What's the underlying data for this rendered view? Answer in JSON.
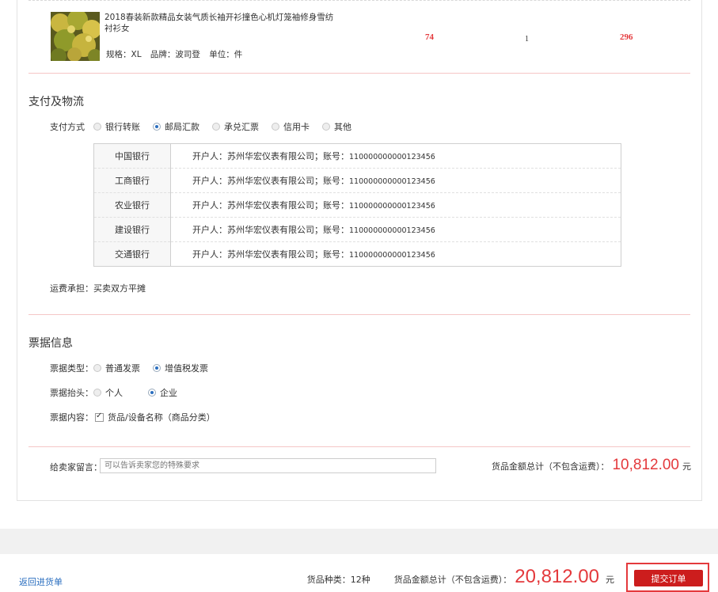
{
  "product": {
    "name": "2018春装新款精品女装气质长袖开衫撞色心机灯笼袖修身雪纺衬衫女",
    "spec_label": "规格：XL",
    "brand_label": "品牌：波司登",
    "unit_label": "单位：件",
    "price": "74",
    "quantity": "1",
    "subtotal": "296"
  },
  "payment": {
    "title": "支付及物流",
    "method_label": "支付方式",
    "options": [
      {
        "label": "银行转账",
        "checked": false
      },
      {
        "label": "邮局汇款",
        "checked": true
      },
      {
        "label": "承兑汇票",
        "checked": false
      },
      {
        "label": "信用卡",
        "checked": false
      },
      {
        "label": "其他",
        "checked": false
      }
    ],
    "banks": [
      {
        "name": "中国银行",
        "info": "开户人：苏州华宏仪表有限公司；账号：",
        "account": "110000000000123456"
      },
      {
        "name": "工商银行",
        "info": "开户人：苏州华宏仪表有限公司；账号：",
        "account": "110000000000123456"
      },
      {
        "name": "农业银行",
        "info": "开户人：苏州华宏仪表有限公司；账号：",
        "account": "110000000000123456"
      },
      {
        "name": "建设银行",
        "info": "开户人：苏州华宏仪表有限公司；账号：",
        "account": "110000000000123456"
      },
      {
        "name": "交通银行",
        "info": "开户人：苏州华宏仪表有限公司；账号：",
        "account": "110000000000123456"
      }
    ],
    "freight_note": "运费承担：买卖双方平摊"
  },
  "invoice": {
    "title": "票据信息",
    "type_label": "票据类型：",
    "type_options": [
      {
        "label": "普通发票",
        "checked": false
      },
      {
        "label": "增值税发票",
        "checked": true
      }
    ],
    "header_label": "票据抬头：",
    "header_options": [
      {
        "label": "个人",
        "checked": false
      },
      {
        "label": "企业",
        "checked": true
      }
    ],
    "content_label": "票据内容：",
    "content_option": {
      "label": "货品/设备名称（商品分类）",
      "checked": true
    }
  },
  "remark": {
    "label": "给卖家留言：",
    "placeholder": "可以告诉卖家您的特殊要求"
  },
  "order_total": {
    "label": "货品金额总计（不包含运费）：",
    "amount": "10,812.00",
    "currency": "元"
  },
  "footer": {
    "back_link": "返回进货单",
    "kinds": "货品种类：12种",
    "total_label": "货品金额总计（不包含运费）：",
    "total_amount": "20,812.00",
    "currency": "元",
    "submit_label": "提交订单"
  },
  "colors": {
    "accent_red": "#e4393c",
    "link_blue": "#2a6ebf",
    "divider_pink": "#f5c6c6"
  }
}
